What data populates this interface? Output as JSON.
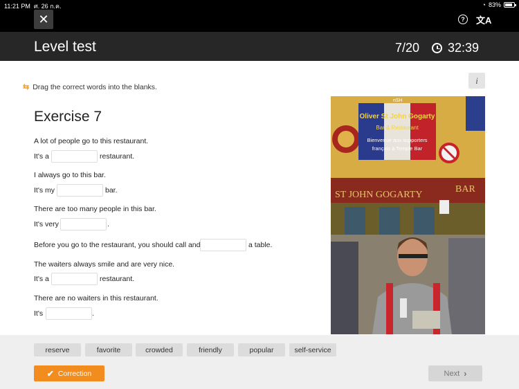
{
  "status_bar": {
    "time": "11:21 PM",
    "date": "ศ. 26 ก.ค.",
    "battery": "83%",
    "battery_level": 0.83
  },
  "top_bar": {
    "close_glyph": "✕",
    "help_glyph": "?",
    "translate_glyph": "文A"
  },
  "header": {
    "title": "Level test",
    "progress": "7/20",
    "timer": "32:39"
  },
  "instruction": {
    "icon": "swap-arrows-icon",
    "text": "Drag the correct words into the blanks."
  },
  "info_button": {
    "label": "i"
  },
  "exercise": {
    "title": "Exercise 7",
    "items": [
      {
        "context": "A lot of people go to this restaurant.",
        "before": "It's a",
        "after": "restaurant."
      },
      {
        "context": "I always go to this bar.",
        "before": "It's my",
        "after": "bar."
      },
      {
        "context": "There are too many people in this bar.",
        "before": "It's very",
        "after": "."
      },
      {
        "context": "",
        "before": "Before you go to the restaurant, you should call and",
        "after": "a table."
      },
      {
        "context": "The waiters always smile and are very nice.",
        "before": "It's a",
        "after": "restaurant."
      },
      {
        "context": "There are no waiters in this restaurant.",
        "before": "It's",
        "after": "."
      }
    ]
  },
  "photo": {
    "top_sign": "Oliver St John Gogarty",
    "sub_sign": "Bar & Restaurant",
    "welcome_1": "Bienvenue aux supporters",
    "welcome_2": "français à Temple Bar",
    "facade": "ST JOHN GOGARTY",
    "bar_word": "BAR",
    "tag": "nSH"
  },
  "word_bank": [
    "reserve",
    "favorite",
    "crowded",
    "friendly",
    "popular",
    "self-service"
  ],
  "buttons": {
    "correction": "Correction",
    "next": "Next"
  },
  "colors": {
    "accent": "#f28c1e",
    "header_bg": "#272727",
    "topbar_bg": "#000000"
  }
}
